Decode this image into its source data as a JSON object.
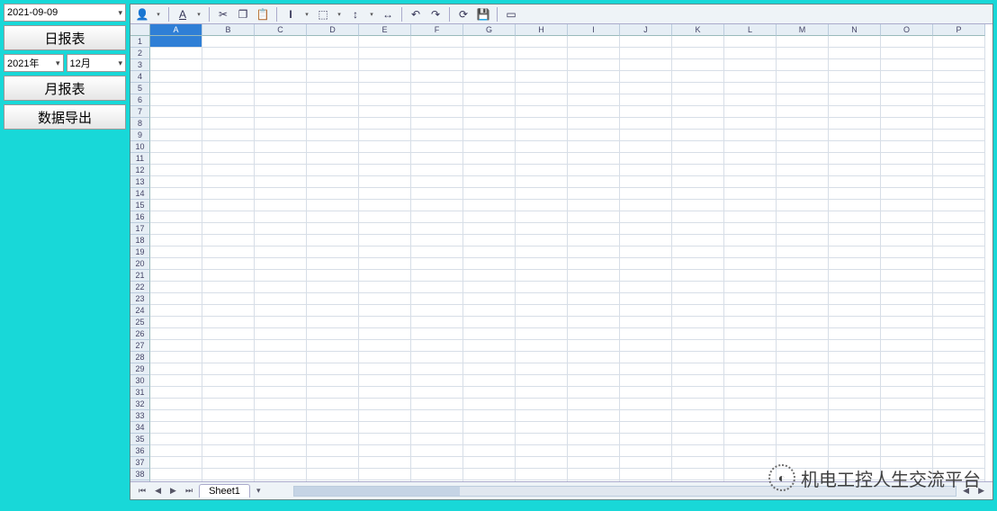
{
  "sidebar": {
    "date_value": "2021-09-09",
    "year_value": "2021年",
    "month_value": "12月",
    "btn_daily": "日报表",
    "btn_monthly": "月报表",
    "btn_export": "数据导出"
  },
  "toolbar": {
    "icons": [
      "person",
      "font-color",
      "cut",
      "copy",
      "paste",
      "bold",
      "merge",
      "row-height",
      "col-width",
      "undo",
      "redo",
      "refresh",
      "save",
      "open"
    ]
  },
  "sheet": {
    "columns": [
      "A",
      "B",
      "C",
      "D",
      "E",
      "F",
      "G",
      "H",
      "I",
      "J",
      "K",
      "L",
      "M",
      "N",
      "O",
      "P"
    ],
    "row_count": 40,
    "selected_cell": "A1",
    "tab_label": "Sheet1"
  },
  "watermark": {
    "text": "机电工控人生交流平台"
  }
}
